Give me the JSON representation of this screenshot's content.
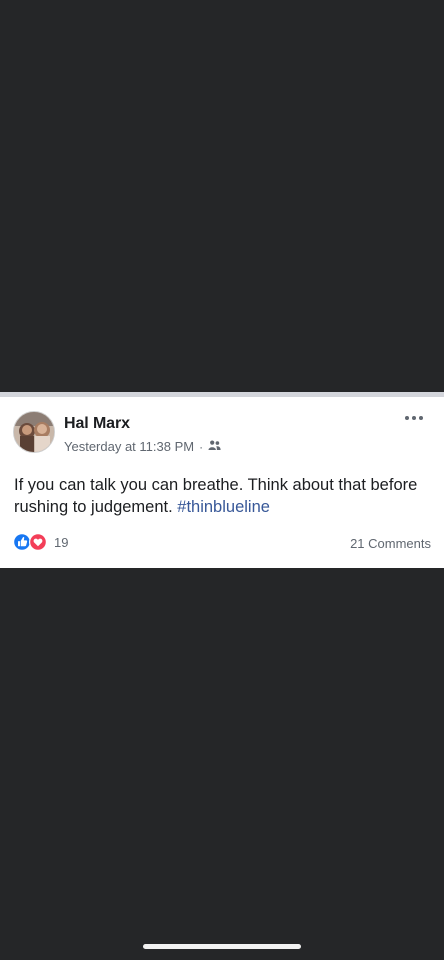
{
  "post": {
    "author": "Hal Marx",
    "timestamp": "Yesterday at 11:38 PM",
    "separator": "·",
    "audience_icon": "friends-icon",
    "text": "If you can talk you can breathe. Think about that before rushing to judgement. ",
    "hashtag": "#thinblueline",
    "reaction_count": "19",
    "comments_label": "21 Comments"
  },
  "colors": {
    "background": "#252628",
    "card": "#ffffff",
    "card_top_border": "#d3d5db",
    "primary_text": "#1c1e21",
    "secondary_text": "#606770",
    "hashtag": "#385898",
    "like_blue": "#1877f2",
    "love_red": "#f33e58"
  }
}
